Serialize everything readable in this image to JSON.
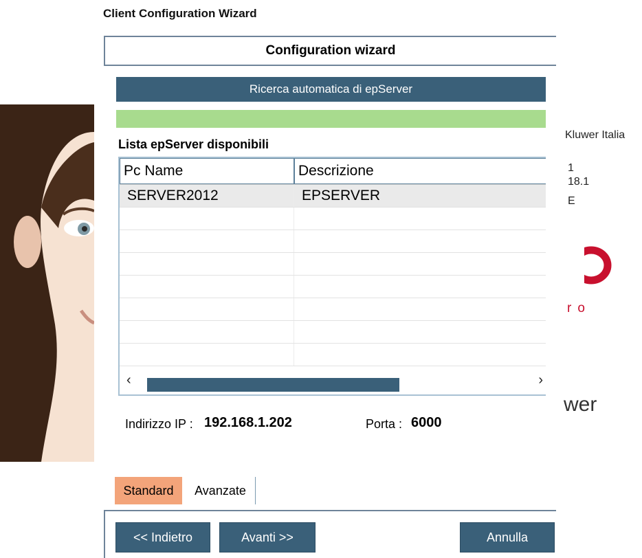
{
  "window": {
    "title": "Client Configuration Wizard"
  },
  "wizard": {
    "header": "Configuration wizard",
    "step_title": "Ricerca automatica di epServer",
    "progress": 1.0
  },
  "background": {
    "line1": "Kluwer Italia",
    "line2": "1",
    "line3": "18.1",
    "line4": "E",
    "logo_text": "ro",
    "power_text": "wer",
    "brand_color": "#c8102e"
  },
  "server_list": {
    "caption": "Lista epServer disponibili",
    "columns": [
      "Pc Name",
      "Descrizione"
    ],
    "rows": [
      {
        "pc_name": "SERVER2012",
        "description": "EPSERVER"
      }
    ]
  },
  "connection": {
    "ip_label": "Indirizzo IP :",
    "ip_value": "192.168.1.202",
    "port_label": "Porta :",
    "port_value": "6000"
  },
  "tabs": [
    "Standard",
    "Avanzate"
  ],
  "buttons": {
    "back": "<< Indietro",
    "next": "Avanti >>",
    "cancel": "Annulla"
  },
  "colors": {
    "accent": "#3a6079",
    "progress": "#a8db8e",
    "active_tab": "#f3a47a"
  }
}
